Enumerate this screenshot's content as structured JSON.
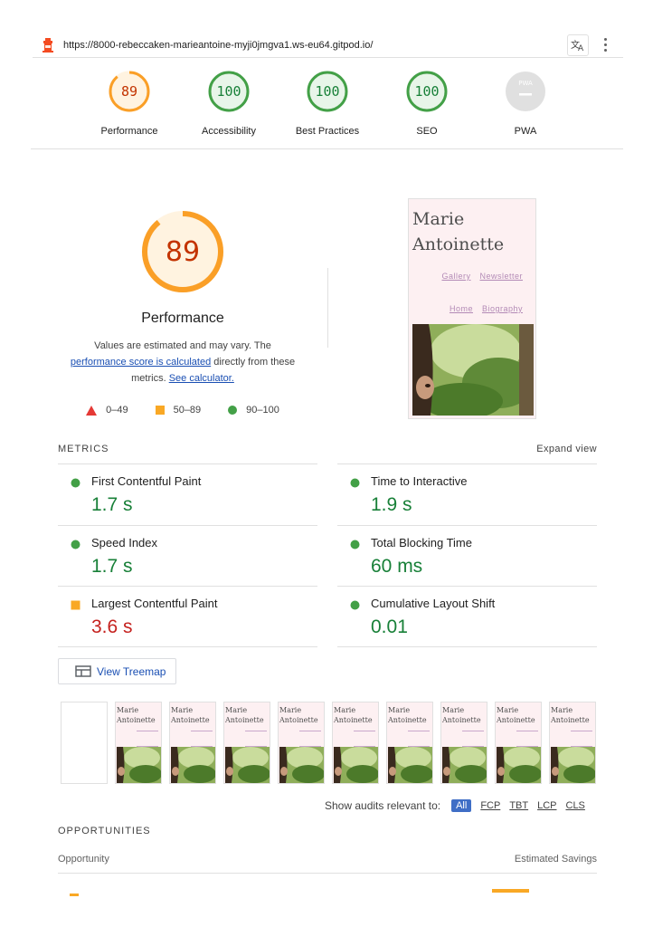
{
  "topbar": {
    "url": "https://8000-rebeccaken-marieantoine-myji0jmgva1.ws-eu64.gitpod.io/"
  },
  "summary_gauges": [
    {
      "label": "Performance",
      "score": "89",
      "color": "#fa9f27"
    },
    {
      "label": "Accessibility",
      "score": "100",
      "color": "#43a047"
    },
    {
      "label": "Best Practices",
      "score": "100",
      "color": "#43a047"
    },
    {
      "label": "SEO",
      "score": "100",
      "color": "#43a047"
    },
    {
      "label": "PWA",
      "badge": "PWA",
      "color": "#9e9e9e"
    }
  ],
  "performance": {
    "score": "89",
    "title": "Performance",
    "desc_prefix": "Values are estimated and may vary. The ",
    "desc_link1": "performance score is calculated",
    "desc_middle": " directly from these metrics. ",
    "desc_link2": "See calculator.",
    "legend": {
      "fail": "0–49",
      "average": "50–89",
      "pass": "90–100"
    }
  },
  "screenshot": {
    "title": "Marie Antoinette",
    "links_row1": [
      "Gallery",
      "Newsletter"
    ],
    "links_row2": [
      "Home",
      "Biography"
    ]
  },
  "metrics": {
    "header": "METRICS",
    "expand": "Expand view",
    "items": [
      {
        "name": "First Contentful Paint",
        "value": "1.7 s",
        "rating": "pass"
      },
      {
        "name": "Time to Interactive",
        "value": "1.9 s",
        "rating": "pass"
      },
      {
        "name": "Speed Index",
        "value": "1.7 s",
        "rating": "pass"
      },
      {
        "name": "Total Blocking Time",
        "value": "60 ms",
        "rating": "pass"
      },
      {
        "name": "Largest Contentful Paint",
        "value": "3.6 s",
        "rating": "average"
      },
      {
        "name": "Cumulative Layout Shift",
        "value": "0.01",
        "rating": "pass"
      }
    ]
  },
  "treemap_button": "View Treemap",
  "filmstrip": {
    "frame_title": "Marie Antoinette"
  },
  "audit_filter": {
    "label": "Show audits relevant to:",
    "options": [
      "All",
      "FCP",
      "TBT",
      "LCP",
      "CLS"
    ],
    "active": "All"
  },
  "opportunities": {
    "header": "OPPORTUNITIES",
    "col_left": "Opportunity",
    "col_right": "Estimated Savings"
  },
  "colors": {
    "pass": "#188038",
    "average": "#c5221f",
    "orange": "#fa9f27",
    "link": "#1a4fb3"
  }
}
